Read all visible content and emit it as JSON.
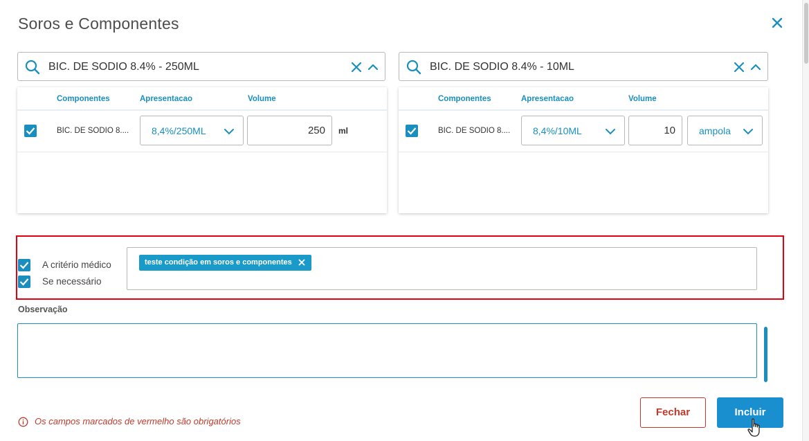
{
  "dialog": {
    "title": "Soros e Componentes",
    "close_icon": "close-icon"
  },
  "colors": {
    "accent": "#1a8fbf",
    "danger": "#c0392b",
    "highlight_border": "#e3000f"
  },
  "left_panel": {
    "search_value": "BIC. DE SODIO 8.4% - 250ML",
    "columns": [
      "Componentes",
      "Apresentacao",
      "Volume"
    ],
    "rows": [
      {
        "checked": true,
        "componente": "BIC. DE SODIO 8....",
        "apresentacao": "8,4%/250ML",
        "volume": "250",
        "unidade": "ml"
      }
    ]
  },
  "right_panel": {
    "search_value": "BIC. DE SODIO 8.4% - 10ML",
    "columns": [
      "Componentes",
      "Apresentacao",
      "Volume"
    ],
    "rows": [
      {
        "checked": true,
        "componente": "BIC. DE SODIO 8....",
        "apresentacao": "8,4%/10ML",
        "volume": "10",
        "unidade": "ampola"
      }
    ]
  },
  "conditions": {
    "a_criterio_medico": {
      "label": "A critério médico",
      "checked": true
    },
    "se_necessario": {
      "label": "Se necessário",
      "checked": true
    },
    "tags": [
      "teste condição em soros e componentes"
    ]
  },
  "observacao": {
    "label": "Observação",
    "value": ""
  },
  "footer": {
    "required_message": "Os campos marcados de vermelho são obrigatórios",
    "fechar_label": "Fechar",
    "incluir_label": "Incluir"
  }
}
